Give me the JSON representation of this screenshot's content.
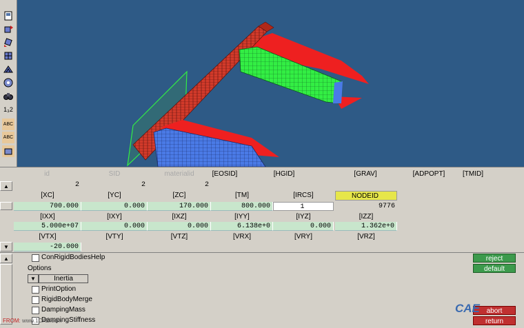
{
  "toolbar": {
    "tools": [
      {
        "icon": "view-icon"
      },
      {
        "icon": "rotate-icon"
      },
      {
        "icon": "rotate-alt-icon"
      },
      {
        "icon": "fit-icon"
      },
      {
        "icon": "mesh-icon"
      },
      {
        "icon": "shade-icon"
      },
      {
        "icon": "cycle-icon"
      },
      {
        "icon": "binoculars-icon"
      },
      {
        "icon": "numbering-icon",
        "text": "1₃2"
      },
      {
        "icon": "label-abc-icon",
        "text": "ABC"
      },
      {
        "icon": "label-abc-alt-icon",
        "text": "ABC"
      },
      {
        "icon": "shape-icon"
      }
    ]
  },
  "card": {
    "row1": {
      "headers": [
        "id",
        "SID",
        "materialid",
        "[EOSID]",
        "[HGID]",
        "[GRAV]",
        "[ADPOPT]",
        "[TMID]"
      ],
      "values": [
        "2",
        "2",
        "2"
      ]
    },
    "row2": {
      "headers": [
        "[XC]",
        "[YC]",
        "[ZC]",
        "[TM]",
        "[IRCS]",
        "NODEID"
      ],
      "values": [
        "700.000",
        "0.000",
        "170.000",
        "800.000",
        "1",
        "9776"
      ]
    },
    "row3": {
      "headers": [
        "[IXX]",
        "[IXY]",
        "[IXZ]",
        "[IYY]",
        "[IYZ]",
        "[IZZ]"
      ],
      "values": [
        "5.000e+07",
        "0.000",
        "0.000",
        "6.138e+0",
        "0.000",
        "1.362e+0"
      ]
    },
    "row4": {
      "headers": [
        "[VTX]",
        "[VTY]",
        "[VTZ]",
        "[VRX]",
        "[VRY]",
        "[VRZ]"
      ],
      "values": [
        "-20.000"
      ]
    }
  },
  "options": {
    "help_label": "ConRigidBodiesHelp",
    "section_label": "Options",
    "dropdown_value": "Inertia",
    "items": [
      "PrintOption",
      "RigidBodyMerge",
      "DampingMass",
      "DampingStiffness"
    ]
  },
  "buttons": {
    "reject": "reject",
    "default": "default",
    "abort": "abort",
    "return": "return"
  },
  "watermark": {
    "logo": "CAE",
    "url": "www.1CAE.com",
    "prefix": "FROM:"
  },
  "colors": {
    "viewport_bg": "#2e5a86",
    "green_cell": "#c8e6cc",
    "nodeid_highlight": "#e6e64a",
    "rigid_body_green": "#33ee44",
    "rigid_body_blue": "#4a7ae6",
    "beam_red": "#d23a2a"
  }
}
